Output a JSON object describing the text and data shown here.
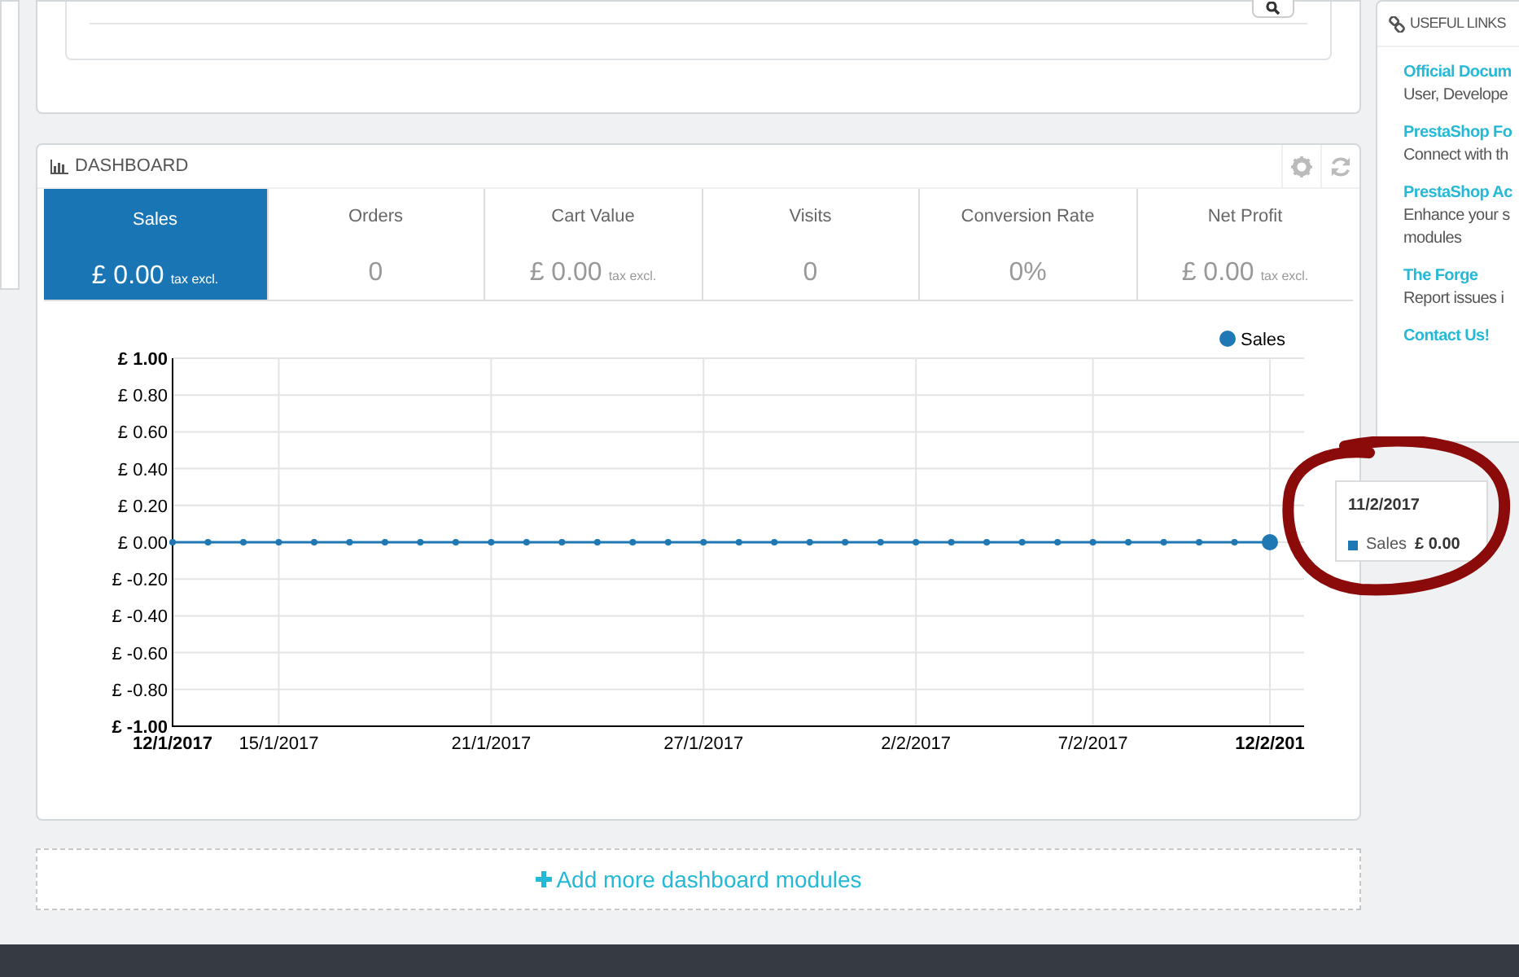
{
  "dashboard": {
    "title": "DASHBOARD",
    "kpis": [
      {
        "label": "Sales",
        "value": "£ 0.00",
        "suffix": "tax excl.",
        "selected": true
      },
      {
        "label": "Orders",
        "value": "0",
        "selected": false
      },
      {
        "label": "Cart Value",
        "value": "£ 0.00",
        "suffix": "tax excl.",
        "selected": false
      },
      {
        "label": "Visits",
        "value": "0",
        "selected": false
      },
      {
        "label": "Conversion Rate",
        "value": "0%",
        "selected": false
      },
      {
        "label": "Net Profit",
        "value": "£ 0.00",
        "suffix": "tax excl.",
        "selected": false
      }
    ],
    "chart_data": {
      "type": "line",
      "categories": [
        "12/1/2017",
        null,
        null,
        "15/1/2017",
        null,
        null,
        null,
        null,
        null,
        "21/1/2017",
        null,
        null,
        null,
        null,
        null,
        "27/1/2017",
        null,
        null,
        null,
        null,
        null,
        "2/2/2017",
        null,
        null,
        null,
        null,
        "7/2/2017",
        null,
        null,
        null,
        null,
        "12/2/201"
      ],
      "series": [
        {
          "name": "Sales",
          "color": "#1f77b4",
          "marker": true,
          "values": [
            0,
            0,
            0,
            0,
            0,
            0,
            0,
            0,
            0,
            0,
            0,
            0,
            0,
            0,
            0,
            0,
            0,
            0,
            0,
            0,
            0,
            0,
            0,
            0,
            0,
            0,
            0,
            0,
            0,
            0,
            0,
            0
          ]
        }
      ],
      "ylim": [
        -1,
        1
      ],
      "grid": true,
      "yticks": [
        {
          "value": 1,
          "label": "£ 1.00"
        },
        {
          "value": 0.8,
          "label": "£ 0.80"
        },
        {
          "value": 0.6,
          "label": "£ 0.60"
        },
        {
          "value": 0.4,
          "label": "£ 0.40"
        },
        {
          "value": 0.2,
          "label": "£ 0.20"
        },
        {
          "value": 0,
          "label": "£ 0.00"
        },
        {
          "value": -0.2,
          "label": "£ -0.20"
        },
        {
          "value": -0.4,
          "label": "£ -0.40"
        },
        {
          "value": -0.6,
          "label": "£ -0.60"
        },
        {
          "value": -0.8,
          "label": "£ -0.80"
        },
        {
          "value": -1,
          "label": "£ -1.00"
        }
      ]
    },
    "tooltip": {
      "date": "11/2/2017",
      "series": "Sales",
      "value": "£ 0.00"
    }
  },
  "add_modules": {
    "label": "Add more dashboard modules"
  },
  "useful_links": {
    "title": "USEFUL LINKS",
    "items": [
      {
        "title": "Official Docum",
        "description": "User, Develope"
      },
      {
        "title": "PrestaShop Fo",
        "description": "Connect with th"
      },
      {
        "title": "PrestaShop Ac",
        "description": "Enhance your s modules"
      },
      {
        "title": "The Forge",
        "description": "Report issues i"
      },
      {
        "title": "Contact Us!"
      }
    ]
  }
}
